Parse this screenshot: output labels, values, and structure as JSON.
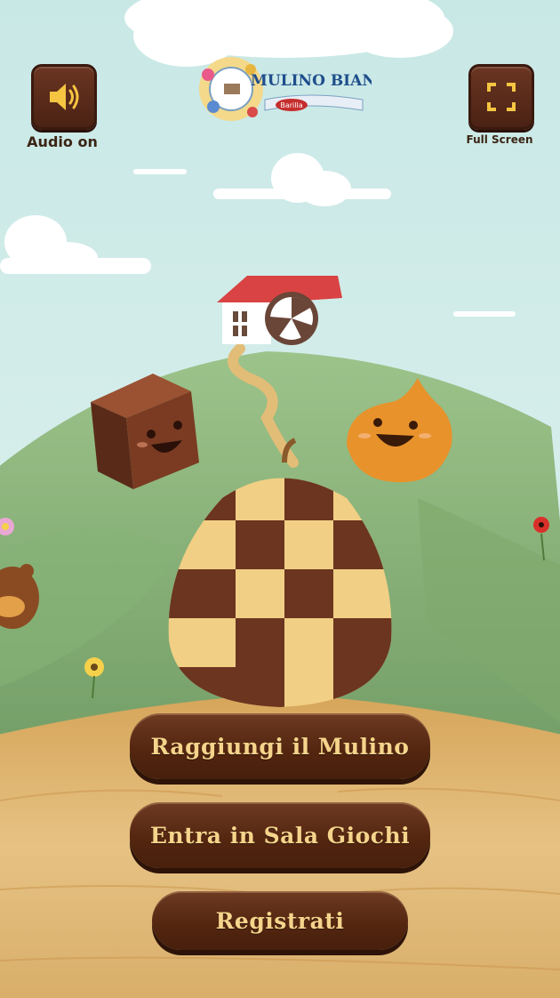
{
  "header": {
    "audio_label": "Audio on",
    "fullscreen_label": "Full Screen",
    "logo": {
      "brand": "MULINO BIANCO",
      "sub_brand": "Barilla"
    }
  },
  "menu": {
    "buttons": [
      {
        "label": "Raggiungi il Mulino"
      },
      {
        "label": "Entra in Sala Giochi"
      },
      {
        "label": "Registrati"
      }
    ]
  },
  "colors": {
    "button_bg": "#52250f",
    "button_text": "#f5d48b",
    "hill": "#8fb87e",
    "sky": "#cfeaea",
    "ground": "#e0b874"
  },
  "icons": [
    "speaker-icon",
    "fullscreen-icon"
  ]
}
